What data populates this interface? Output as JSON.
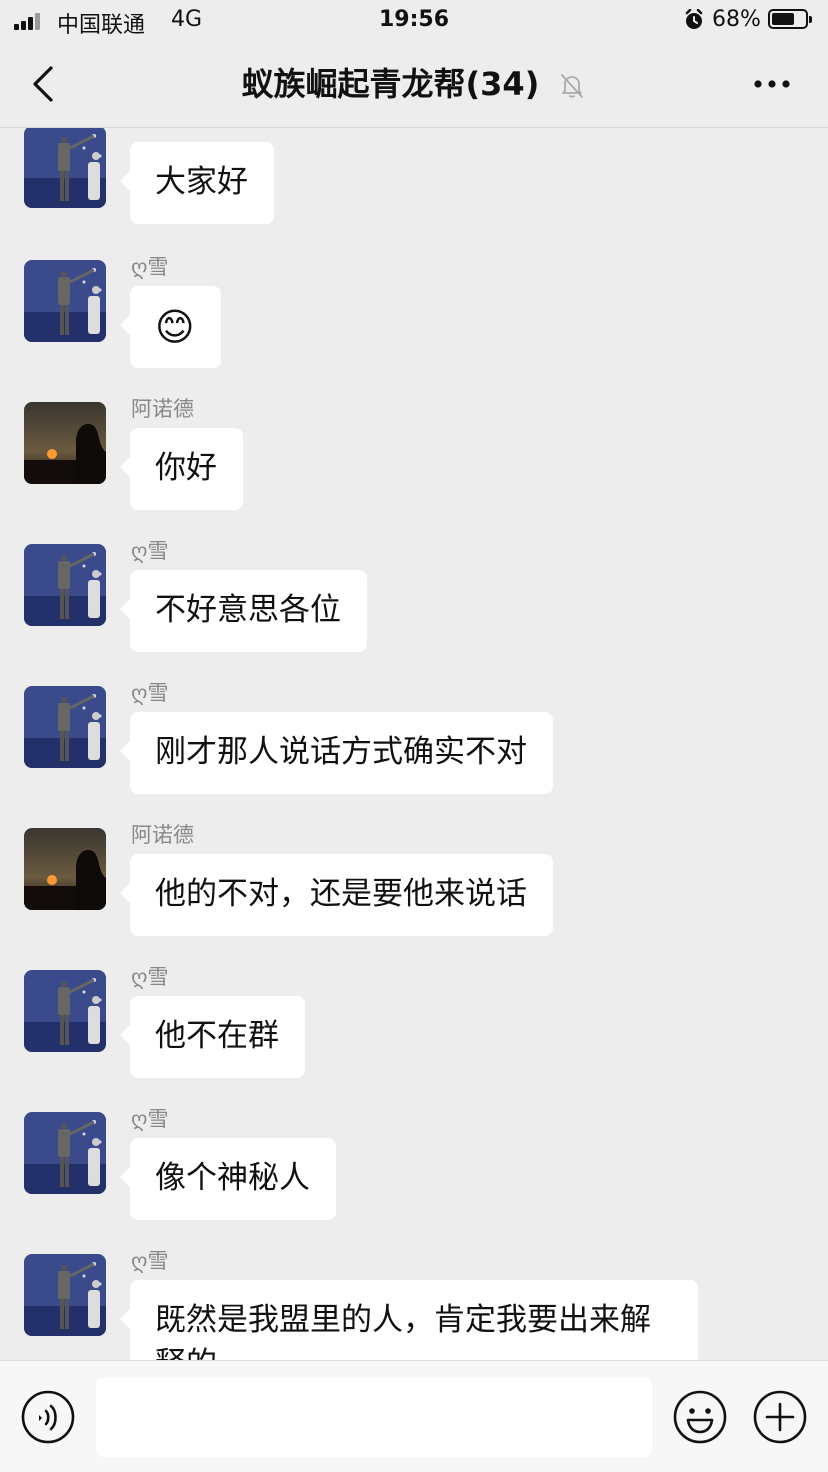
{
  "status_bar": {
    "carrier": "中国联通",
    "network": "4G",
    "time": "19:56",
    "battery_percent": "68%",
    "battery_level": 0.68,
    "icons": [
      "signal-bars-icon",
      "alarm-icon",
      "battery-icon"
    ]
  },
  "nav": {
    "title": "蚁族崛起青龙帮(34)",
    "back_icon": "chevron-left-icon",
    "mute_icon": "bell-muted-icon",
    "more_icon": "ellipsis-icon"
  },
  "messages": [
    {
      "sender": "ღ雪",
      "text": "大家好",
      "avatar": "anime-couple"
    },
    {
      "sender": "ღ雪",
      "text": "😊",
      "avatar": "anime-couple"
    },
    {
      "sender": "阿诺德",
      "text": "你好",
      "avatar": "sunset-silhouette"
    },
    {
      "sender": "ღ雪",
      "text": "不好意思各位",
      "avatar": "anime-couple"
    },
    {
      "sender": "ღ雪",
      "text": "刚才那人说话方式确实不对",
      "avatar": "anime-couple"
    },
    {
      "sender": "阿诺德",
      "text": "他的不对，还是要他来说话",
      "avatar": "sunset-silhouette"
    },
    {
      "sender": "ღ雪",
      "text": "他不在群",
      "avatar": "anime-couple"
    },
    {
      "sender": "ღ雪",
      "text": "像个神秘人",
      "avatar": "anime-couple"
    },
    {
      "sender": "ღ雪",
      "text": "既然是我盟里的人，肯定我要出来解释的",
      "avatar": "anime-couple"
    }
  ],
  "input_bar": {
    "voice_icon": "voice-icon",
    "message_value": "",
    "emoji_icon": "emoji-icon",
    "add_icon": "plus-circle-icon"
  },
  "colors": {
    "background": "#ededed",
    "bubble": "#ffffff",
    "sender_name": "#888888",
    "input_bar": "#f7f7f7"
  }
}
